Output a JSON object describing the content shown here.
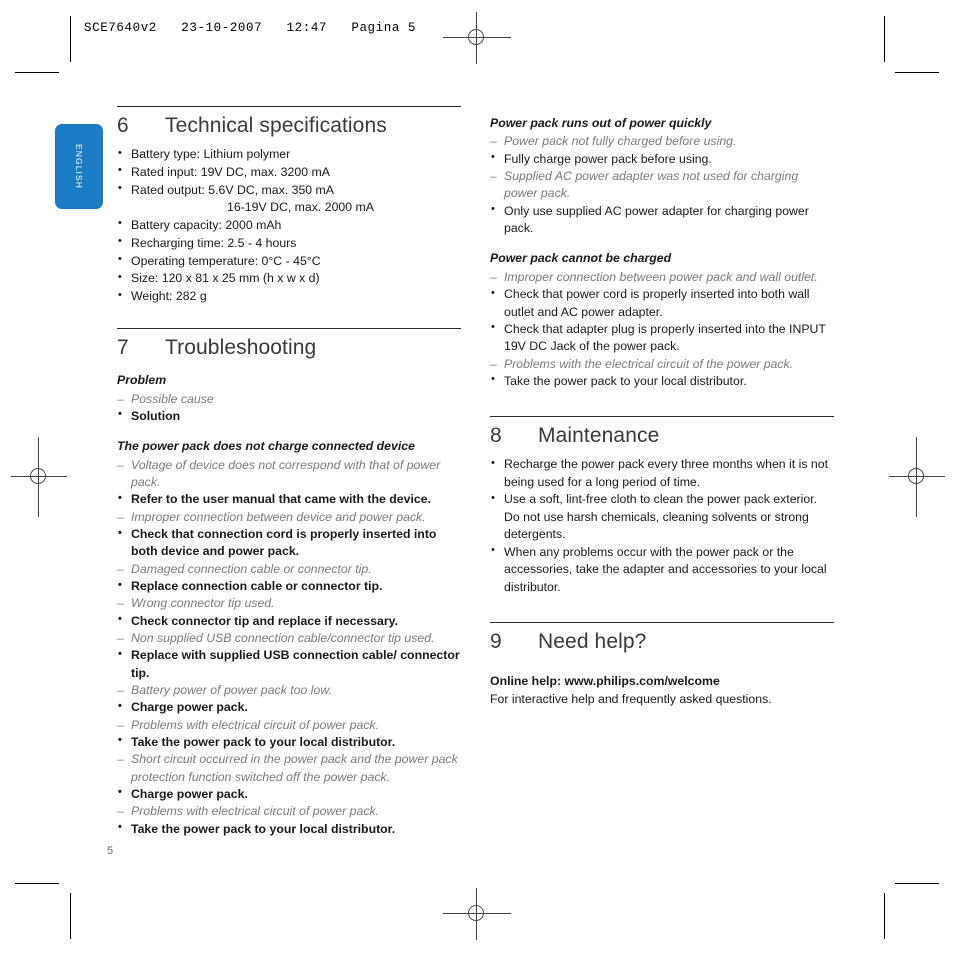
{
  "printer_header": "SCE7640v2   23-10-2007   12:47   Pagina 5",
  "language_tab": "ENGLISH",
  "page_number": "5",
  "colors": {
    "tab_blue": "#1a7cc4",
    "heading_gray": "#3a3a3a",
    "cause_gray": "#7b7b7b",
    "rule_black": "#2b2b2b"
  },
  "left_column": {
    "tech_spec": {
      "number": "6",
      "title": "Technical specifications",
      "items": [
        {
          "text": "Battery type: Lithium polymer"
        },
        {
          "text": "Rated input: 19V DC, max. 3200 mA"
        },
        {
          "text": "Rated output: 5.6V DC, max. 350 mA",
          "cont": "16-19V DC, max. 2000 mA"
        },
        {
          "text": "Battery capacity: 2000 mAh"
        },
        {
          "text": "Recharging time: 2.5 - 4 hours"
        },
        {
          "text": "Operating temperature: 0°C - 45°C"
        },
        {
          "text": "Size: 120 x 81 x 25 mm (h x w x d)"
        },
        {
          "text": "Weight: 282 g"
        }
      ]
    },
    "troubleshooting": {
      "number": "7",
      "title": "Troubleshooting",
      "legend": {
        "title": "Problem",
        "cause": "Possible cause",
        "solution": "Solution"
      },
      "blocks": [
        {
          "title": "The power pack does not charge connected device",
          "lines": [
            {
              "kind": "cause",
              "text": "Voltage of device does not correspond with that of power pack."
            },
            {
              "kind": "solution",
              "text": "Refer to the user manual that came with the device."
            },
            {
              "kind": "cause",
              "text": "Improper connection between device and power pack."
            },
            {
              "kind": "solution",
              "text": "Check that connection cord is properly inserted into both device and power pack."
            },
            {
              "kind": "cause",
              "text": "Damaged connection cable or connector tip."
            },
            {
              "kind": "solution",
              "text": "Replace connection cable or connector tip."
            },
            {
              "kind": "cause",
              "text": "Wrong connector tip used."
            },
            {
              "kind": "solution",
              "text": "Check connector tip and replace if necessary."
            },
            {
              "kind": "cause",
              "text": "Non supplied USB connection cable/connector tip used."
            },
            {
              "kind": "solution",
              "text": "Replace with supplied USB connection cable/ connector tip."
            },
            {
              "kind": "cause",
              "text": "Battery power of power pack too low."
            },
            {
              "kind": "solution",
              "text": "Charge power pack."
            },
            {
              "kind": "cause",
              "text": "Problems with electrical circuit of power pack."
            },
            {
              "kind": "solution",
              "text": "Take the power pack to your local distributor."
            },
            {
              "kind": "cause",
              "text": "Short circuit occurred in the power pack and the power pack protection function switched off the power pack."
            },
            {
              "kind": "solution",
              "text": "Charge power pack."
            },
            {
              "kind": "cause",
              "text": "Problems with electrical circuit of power pack."
            },
            {
              "kind": "solution",
              "text": "Take the power pack to your local distributor."
            }
          ]
        }
      ]
    }
  },
  "right_column": {
    "blocks": [
      {
        "title": "Power pack runs out of power quickly",
        "lines": [
          {
            "kind": "cause",
            "text": "Power pack not fully charged before using."
          },
          {
            "kind": "solution",
            "text": "Fully charge power pack before using."
          },
          {
            "kind": "cause",
            "text": "Supplied AC power adapter was not used for charging power pack."
          },
          {
            "kind": "solution",
            "text": "Only use supplied AC power adapter for charging power pack."
          }
        ]
      },
      {
        "title": "Power pack cannot be charged",
        "lines": [
          {
            "kind": "cause",
            "text": "Improper connection between power pack and wall outlet."
          },
          {
            "kind": "solution",
            "text": "Check that power cord is properly inserted into both wall outlet and AC power adapter."
          },
          {
            "kind": "solution",
            "text": "Check that adapter plug is properly inserted into the INPUT 19V DC Jack of the power pack."
          },
          {
            "kind": "cause",
            "text": "Problems with the electrical circuit of the power pack."
          },
          {
            "kind": "solution",
            "text": "Take the power pack to your local distributor."
          }
        ]
      }
    ],
    "maintenance": {
      "number": "8",
      "title": "Maintenance",
      "items": [
        {
          "text": "Recharge the power pack every three months when it is not being used for a long period of time."
        },
        {
          "text": "Use a soft, lint-free cloth to clean the power pack exterior. Do not use harsh chemicals, cleaning solvents or strong detergents."
        },
        {
          "text": "When any problems occur with the power pack or the accessories, take the adapter and accessories to your local distributor."
        }
      ]
    },
    "need_help": {
      "number": "9",
      "title": "Need help?",
      "online_help": "Online help: www.philips.com/welcome",
      "subtitle": "For interactive help and frequently asked questions."
    }
  }
}
